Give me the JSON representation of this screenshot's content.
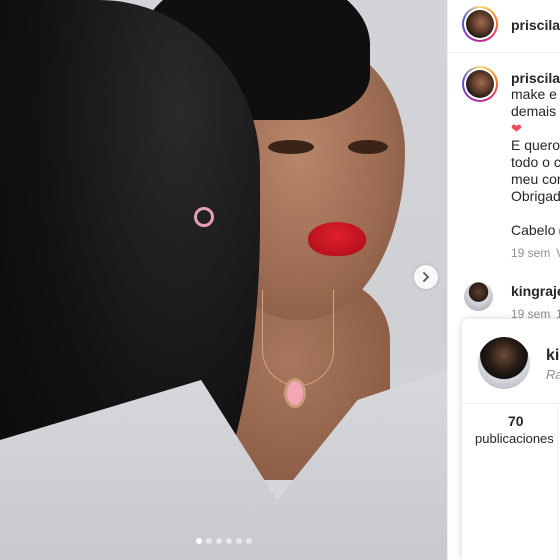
{
  "post": {
    "image_alt": "portrait photo",
    "carousel_dots": 6,
    "active_dot": 0
  },
  "header": {
    "username": "priscila.b"
  },
  "caption": {
    "username": "priscila.b",
    "lines": [
      "make e p",
      "demais ,",
      "E quero a",
      "todo o c",
      "meu cora",
      "Obrigada"
    ],
    "tail_line": "Cabelo",
    "time": "19 sem",
    "time_extra": "V"
  },
  "comment": {
    "username": "kingrajes",
    "time": "19 sem",
    "time_extra": "1"
  },
  "hover_card": {
    "name": "ki",
    "subtitle": "Ra",
    "stat_value": "70",
    "stat_label": "publicaciones"
  },
  "icons": {
    "next": "chevron-right-icon",
    "heart": "heart-icon",
    "verified": "verified-icon"
  }
}
